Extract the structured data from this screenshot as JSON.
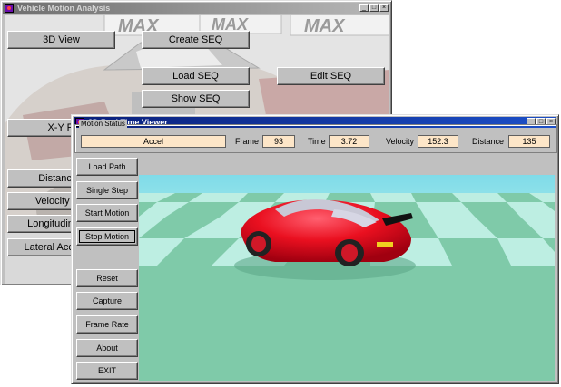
{
  "main_window": {
    "title": "Vehicle Motion Analysis",
    "controls": [
      "_",
      "□",
      "×"
    ],
    "buttons": {
      "view_3d": "3D View",
      "create_seq": "Create SEQ",
      "load_seq": "Load SEQ",
      "edit_seq": "Edit SEQ",
      "show_seq": "Show SEQ",
      "xy_plot": "X-Y P",
      "distance": "Distance",
      "velocity": "Velocity P",
      "longitudinal": "Longitudina",
      "lateral": "Lateral Acce"
    },
    "background_sign": "MAX"
  },
  "viewer_window": {
    "title": "3D Real Time Viewer",
    "controls": [
      "_",
      "□",
      "×"
    ],
    "status_panel": {
      "label": "Motion Status",
      "state": "Accel",
      "frame_label": "Frame",
      "frame_value": "93",
      "time_label": "Time",
      "time_value": "3.72",
      "velocity_label": "Velocity",
      "velocity_value": "152.3",
      "distance_label": "Distance",
      "distance_value": "135"
    },
    "side_buttons": {
      "load_path": "Load Path",
      "single_step": "Single Step",
      "start_motion": "Start Motion",
      "stop_motion": "Stop Motion",
      "reset": "Reset",
      "capture": "Capture",
      "frame_rate": "Frame Rate",
      "about": "About",
      "exit": "EXIT"
    }
  },
  "colors": {
    "window_face": "#c0c0c0",
    "active_title": "#0a1f7a",
    "field_bg": "#fde6c8",
    "sky": "#7ed8e8",
    "ground_light": "#b8ebe0",
    "ground_dark": "#79c9a8",
    "car_body": "#e81020"
  }
}
